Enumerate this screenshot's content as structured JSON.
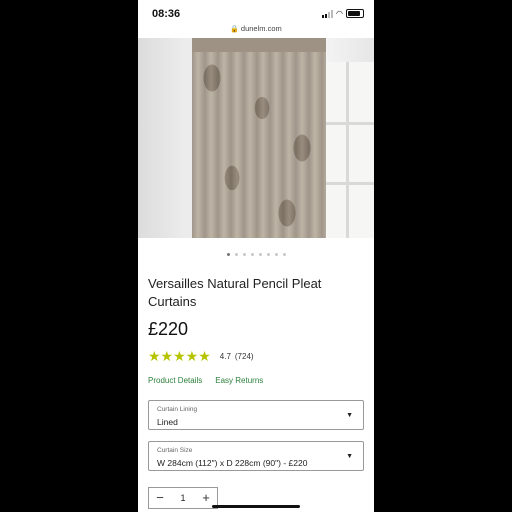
{
  "status_bar": {
    "time": "08:36"
  },
  "url_bar": {
    "domain": "dunelm.com"
  },
  "gallery": {
    "total_images": 8,
    "active_index": 0
  },
  "product": {
    "title": "Versailles Natural Pencil Pleat Curtains",
    "price": "£220",
    "rating_stars": "★★★★★",
    "rating_value": "4.7",
    "rating_count": "(724)",
    "links": [
      "Product Details",
      "Easy Returns"
    ]
  },
  "options": {
    "lining": {
      "label": "Curtain Lining",
      "value": "Lined"
    },
    "size": {
      "label": "Curtain Size",
      "value": "W 284cm (112\") x D 228cm (90\") - £220"
    }
  },
  "quantity": {
    "minus": "−",
    "value": "1",
    "plus": "+"
  },
  "colors": {
    "star": "#b6c400",
    "link": "#2a7f3a"
  }
}
